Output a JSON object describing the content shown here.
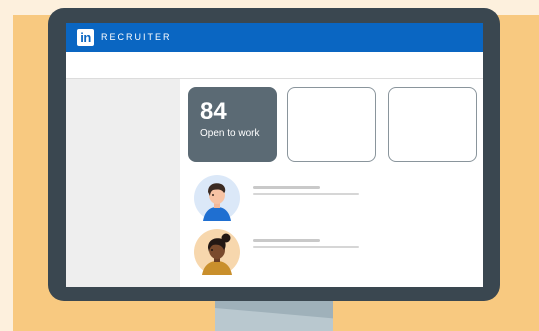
{
  "app": {
    "brand": "RECRUITER",
    "logo_text": "in"
  },
  "stats": {
    "open_to_work": {
      "value": "84",
      "label": "Open to work"
    }
  },
  "candidates": [
    {
      "avatar": "person-avatar-icon"
    },
    {
      "avatar": "person-avatar-icon"
    }
  ],
  "colors": {
    "brand_blue": "#0a66c2",
    "monitor_frame": "#3a4750",
    "stat_card": "#5b6a74",
    "background": "#f8c980"
  }
}
